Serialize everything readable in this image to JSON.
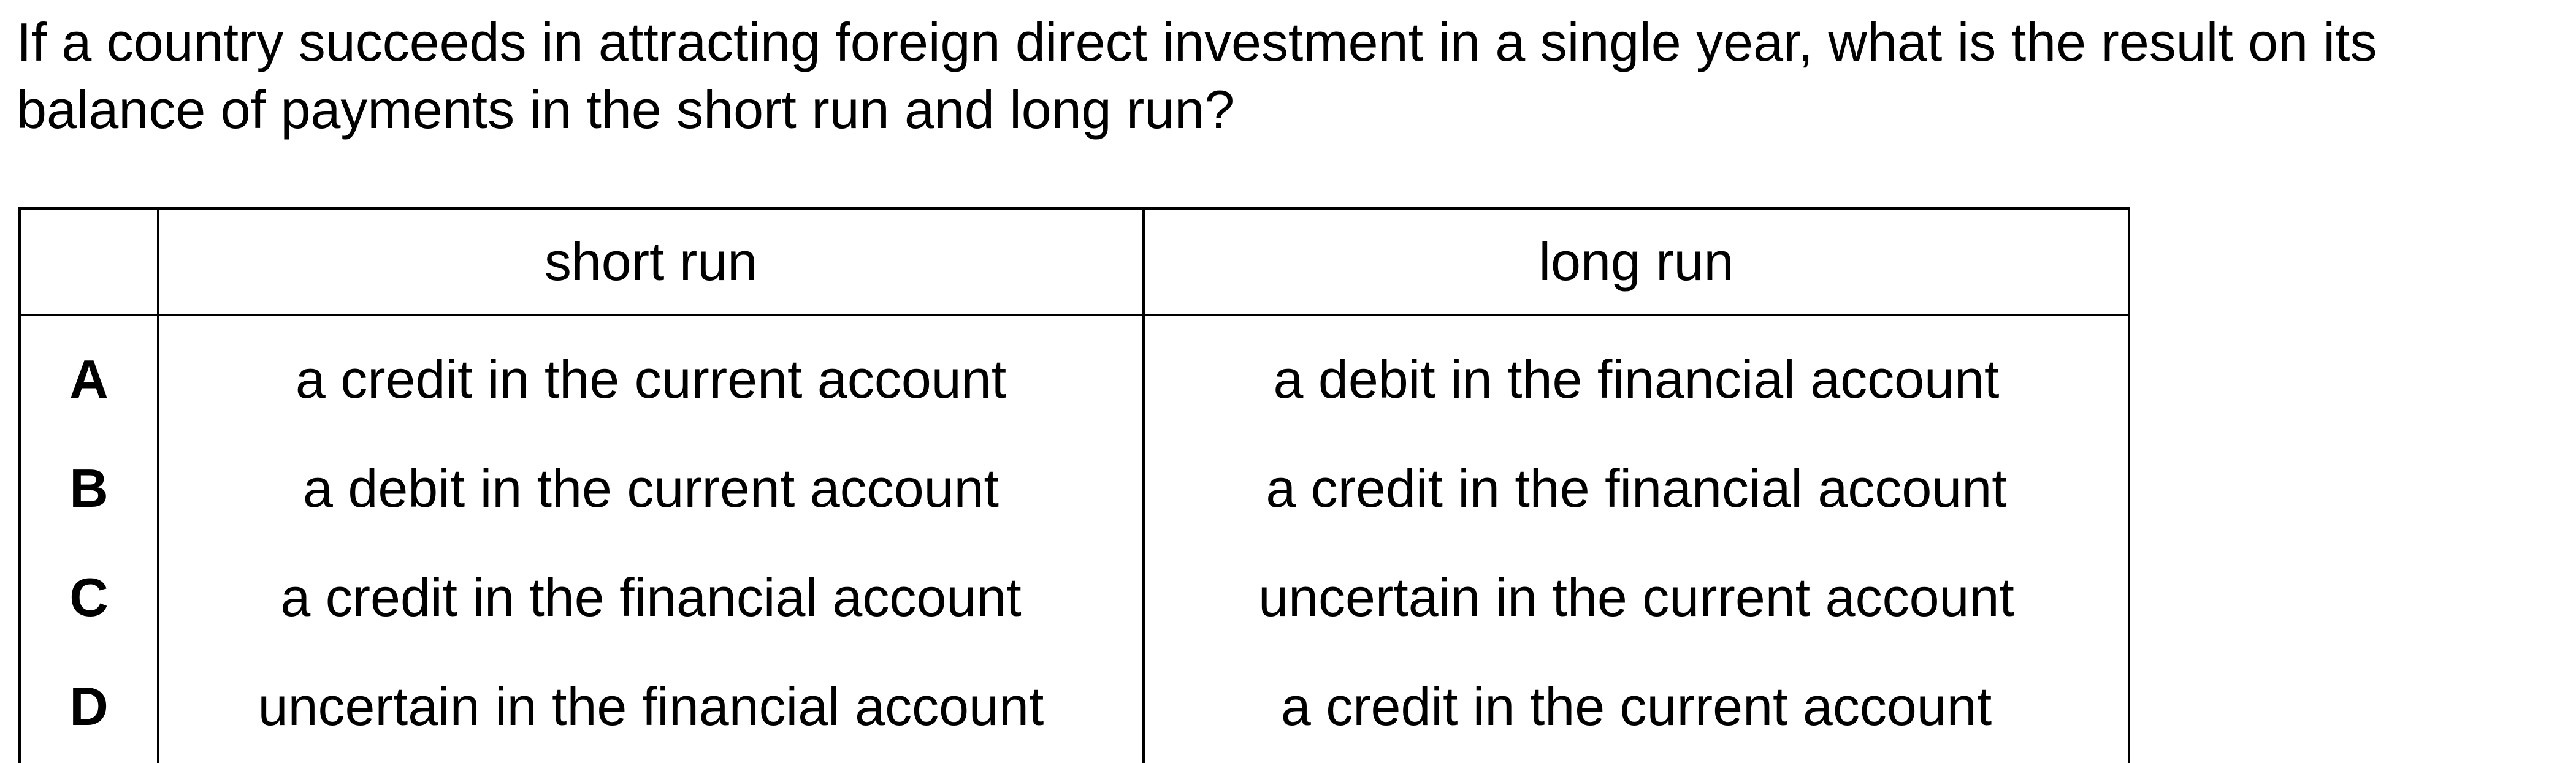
{
  "question": "If a country succeeds in attracting foreign direct investment in a single year, what is the result on its balance of payments in the short run and long run?",
  "table": {
    "headers": [
      "",
      "short run",
      "long run"
    ],
    "rows": [
      {
        "option": "A",
        "short_run": "a credit in the current account",
        "long_run": "a debit in the financial account"
      },
      {
        "option": "B",
        "short_run": "a debit in the current account",
        "long_run": "a credit in the financial account"
      },
      {
        "option": "C",
        "short_run": "a credit in the financial account",
        "long_run": "uncertain in the current account"
      },
      {
        "option": "D",
        "short_run": "uncertain in the financial account",
        "long_run": "a credit in the current account"
      }
    ]
  }
}
